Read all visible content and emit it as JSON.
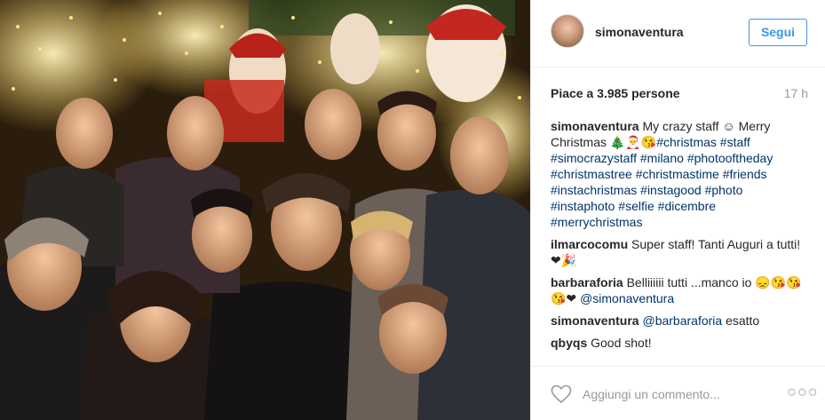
{
  "header": {
    "username": "simonaventura",
    "follow_label": "Segui"
  },
  "post": {
    "likes_text": "Piace a 3.985 persone",
    "time_ago": "17 h"
  },
  "comments": [
    {
      "user": "simonaventura",
      "parts": [
        {
          "t": "text",
          "v": " My crazy staff ☺ Merry Christmas 🎄🎅😘"
        },
        {
          "t": "tag",
          "v": "#christmas"
        },
        {
          "t": "text",
          "v": " "
        },
        {
          "t": "tag",
          "v": "#staff"
        },
        {
          "t": "text",
          "v": " "
        },
        {
          "t": "tag",
          "v": "#simocrazystaff"
        },
        {
          "t": "text",
          "v": " "
        },
        {
          "t": "tag",
          "v": "#milano"
        },
        {
          "t": "text",
          "v": " "
        },
        {
          "t": "tag",
          "v": "#photooftheday"
        },
        {
          "t": "text",
          "v": " "
        },
        {
          "t": "tag",
          "v": "#christmastree"
        },
        {
          "t": "text",
          "v": " "
        },
        {
          "t": "tag",
          "v": "#christmastime"
        },
        {
          "t": "text",
          "v": " "
        },
        {
          "t": "tag",
          "v": "#friends"
        },
        {
          "t": "text",
          "v": " "
        },
        {
          "t": "tag",
          "v": "#instachristmas"
        },
        {
          "t": "text",
          "v": " "
        },
        {
          "t": "tag",
          "v": "#instagood"
        },
        {
          "t": "text",
          "v": " "
        },
        {
          "t": "tag",
          "v": "#photo"
        },
        {
          "t": "text",
          "v": " "
        },
        {
          "t": "tag",
          "v": "#instaphoto"
        },
        {
          "t": "text",
          "v": " "
        },
        {
          "t": "tag",
          "v": "#selfie"
        },
        {
          "t": "text",
          "v": " "
        },
        {
          "t": "tag",
          "v": "#dicembre"
        },
        {
          "t": "text",
          "v": " "
        },
        {
          "t": "tag",
          "v": "#merrychristmas"
        }
      ]
    },
    {
      "user": "ilmarcocomu",
      "parts": [
        {
          "t": "text",
          "v": " Super staff! Tanti Auguri a tutti! ❤🎉"
        }
      ]
    },
    {
      "user": "barbaraforia",
      "parts": [
        {
          "t": "text",
          "v": " Belliiiiii tutti ...manco io 😞😘😘😘❤ "
        },
        {
          "t": "tag",
          "v": "@simonaventura"
        }
      ]
    },
    {
      "user": "simonaventura",
      "parts": [
        {
          "t": "text",
          "v": " "
        },
        {
          "t": "tag",
          "v": "@barbaraforia"
        },
        {
          "t": "text",
          "v": " esatto"
        }
      ]
    },
    {
      "user": "qbyqs",
      "parts": [
        {
          "t": "text",
          "v": " Good shot!"
        }
      ]
    }
  ],
  "footer": {
    "comment_placeholder": "Aggiungi un commento...",
    "more_label": "○○○"
  },
  "colors": {
    "follow_blue": "#3897f0",
    "link_blue": "#003569",
    "muted_gray": "#999999"
  },
  "icons": [
    "heart-icon",
    "more-options-icon"
  ]
}
